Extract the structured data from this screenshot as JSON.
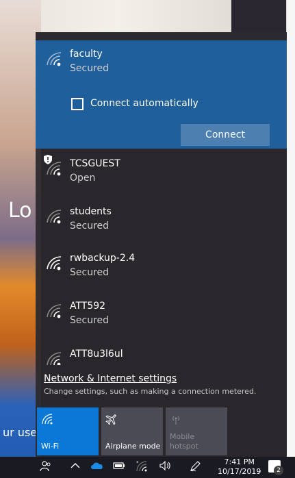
{
  "background": {
    "partial_text_left": "Lo",
    "partial_text_bottom": "ur use"
  },
  "networks": [
    {
      "name": "faculty",
      "status": "Secured",
      "selected": true,
      "icon": "wifi-secured-icon"
    },
    {
      "name": "TCSGUEST",
      "status": "Open",
      "icon": "wifi-open-shield-icon"
    },
    {
      "name": "students",
      "status": "Secured",
      "icon": "wifi-secured-icon"
    },
    {
      "name": "rwbackup-2.4",
      "status": "Secured",
      "icon": "wifi-secured-icon"
    },
    {
      "name": "ATT592",
      "status": "Secured",
      "icon": "wifi-secured-icon"
    },
    {
      "name": "ATT8u3l6ul",
      "status": "",
      "icon": "wifi-secured-icon"
    }
  ],
  "selected_panel": {
    "connect_auto_label": "Connect automatically",
    "connect_button": "Connect"
  },
  "settings": {
    "link": "Network & Internet settings",
    "description": "Change settings, such as making a connection metered."
  },
  "quick_actions": [
    {
      "label": "Wi-Fi",
      "icon": "wifi-icon",
      "active": true
    },
    {
      "label": "Airplane mode",
      "icon": "airplane-icon",
      "active": false
    },
    {
      "label": "Mobile hotspot",
      "icon": "hotspot-icon",
      "active": false,
      "disabled": true
    }
  ],
  "taskbar": {
    "time": "7:41 PM",
    "date": "10/17/2019",
    "notification_count": "2"
  },
  "colors": {
    "selected_bg": "#1f5f9c",
    "wifi_tile": "#0a78d7",
    "flyout_bg": "#2b282c"
  }
}
